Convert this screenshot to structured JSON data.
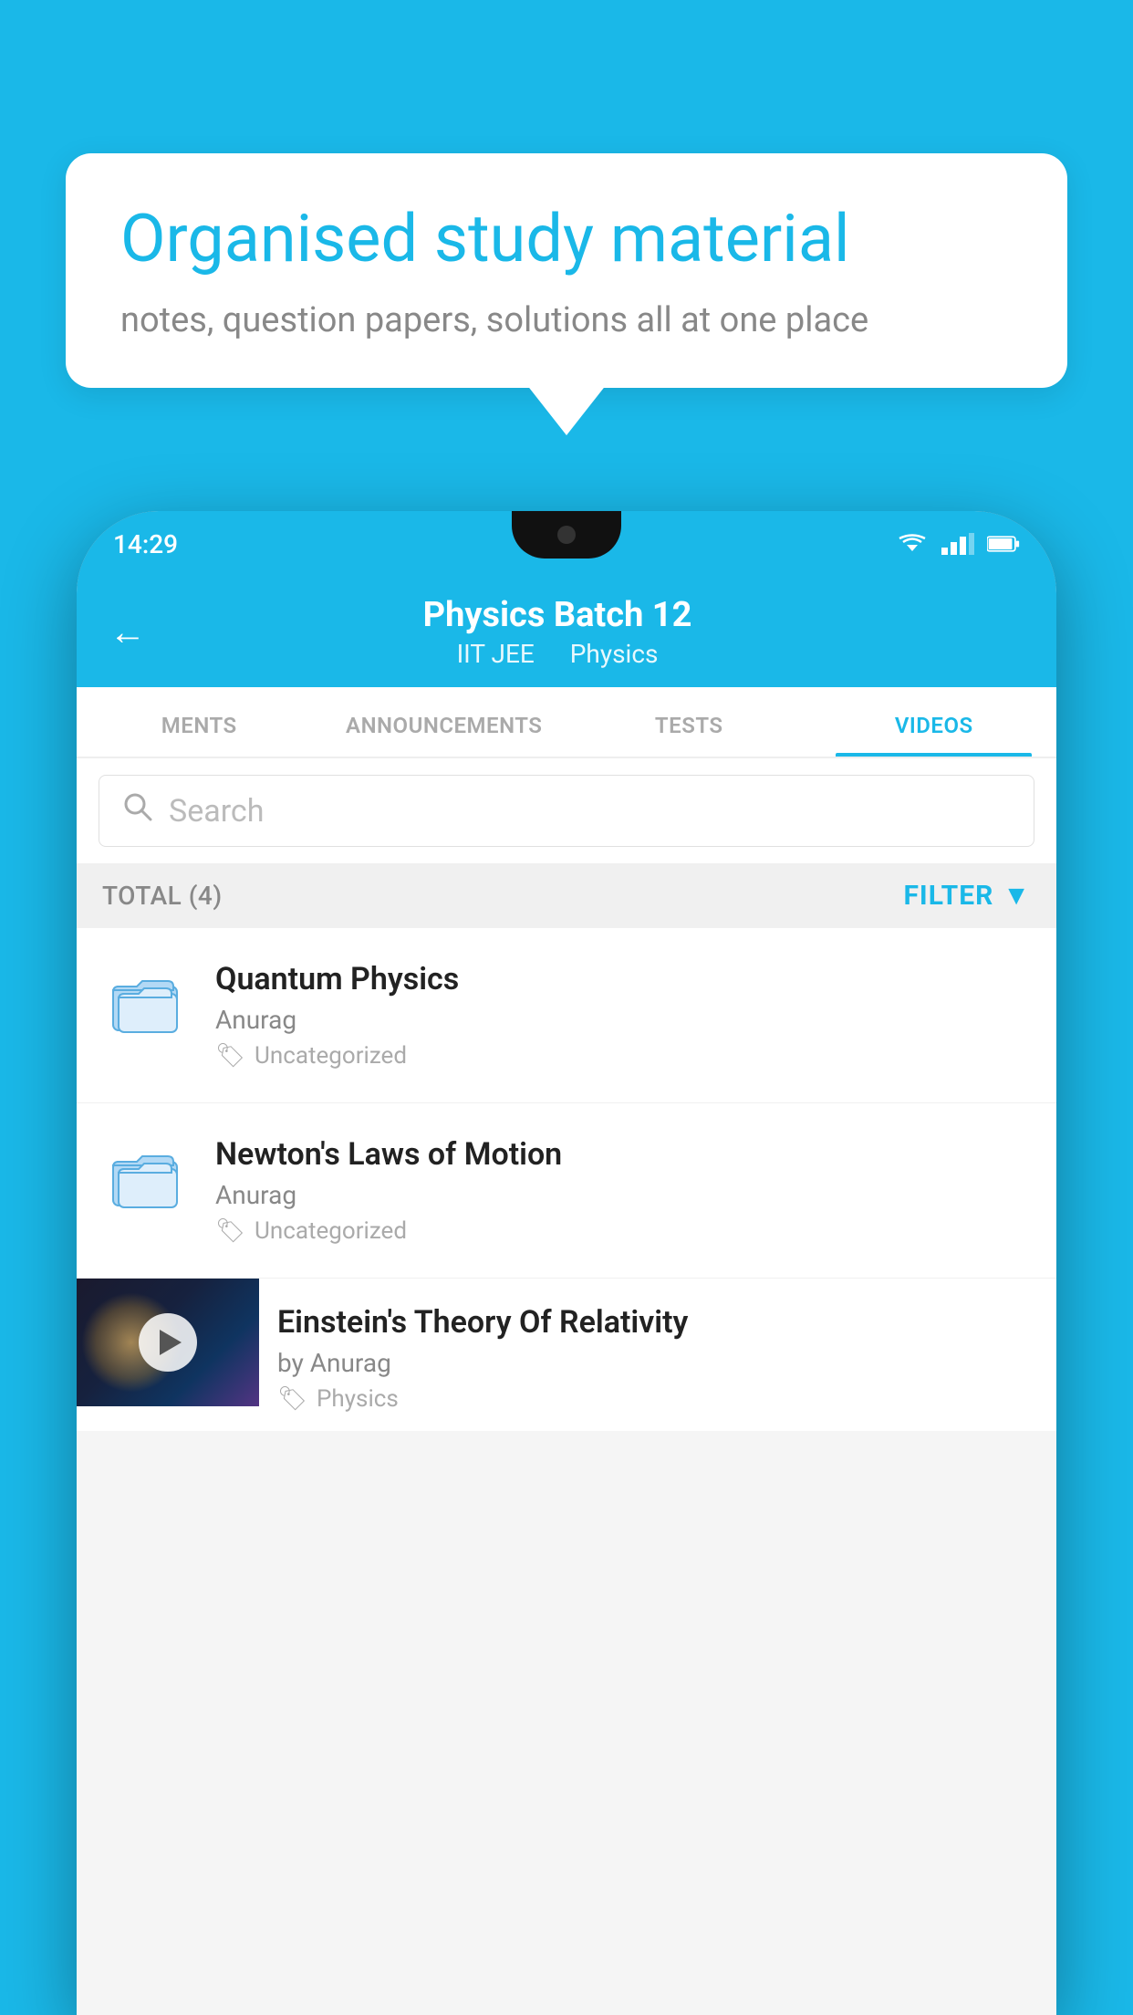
{
  "background_color": "#1ab8e8",
  "speech_bubble": {
    "title": "Organised study material",
    "subtitle": "notes, question papers, solutions all at one place"
  },
  "phone": {
    "status_bar": {
      "time": "14:29"
    },
    "header": {
      "back_label": "←",
      "title": "Physics Batch 12",
      "tag1": "IIT JEE",
      "tag2": "Physics"
    },
    "tabs": [
      {
        "label": "MENTS",
        "active": false
      },
      {
        "label": "ANNOUNCEMENTS",
        "active": false
      },
      {
        "label": "TESTS",
        "active": false
      },
      {
        "label": "VIDEOS",
        "active": true
      }
    ],
    "search": {
      "placeholder": "Search"
    },
    "filter_row": {
      "total_label": "TOTAL (4)",
      "filter_label": "FILTER"
    },
    "videos": [
      {
        "id": 1,
        "title": "Quantum Physics",
        "author": "Anurag",
        "tag": "Uncategorized",
        "type": "folder"
      },
      {
        "id": 2,
        "title": "Newton's Laws of Motion",
        "author": "Anurag",
        "tag": "Uncategorized",
        "type": "folder"
      },
      {
        "id": 3,
        "title": "Einstein's Theory Of Relativity",
        "author": "by Anurag",
        "tag": "Physics",
        "type": "video"
      }
    ]
  }
}
